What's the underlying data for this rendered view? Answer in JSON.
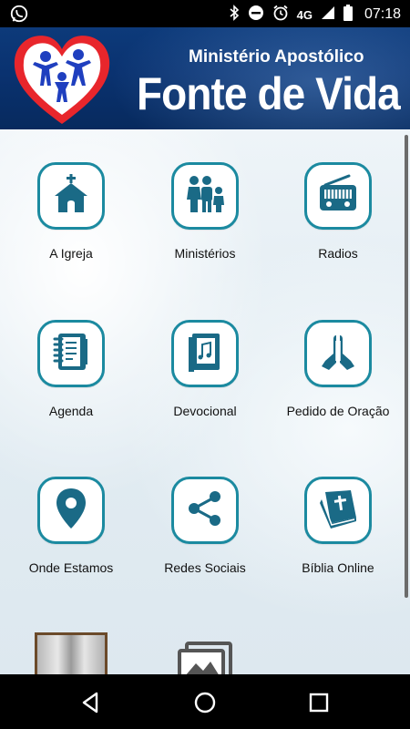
{
  "status_bar": {
    "network": "4G",
    "time": "07:18",
    "icons": [
      "whatsapp-icon",
      "bluetooth-icon",
      "do-not-disturb-icon",
      "alarm-icon",
      "signal-icon",
      "battery-icon"
    ]
  },
  "header": {
    "subtitle": "Ministério Apostólico",
    "title": "Fonte de Vida",
    "logo": "heart-family-logo"
  },
  "menu": {
    "items": [
      {
        "label": "A Igreja",
        "icon": "church-icon"
      },
      {
        "label": "Ministérios",
        "icon": "people-icon"
      },
      {
        "label": "Radios",
        "icon": "radio-icon"
      },
      {
        "label": "Agenda",
        "icon": "notebook-icon"
      },
      {
        "label": "Devocional",
        "icon": "music-book-icon"
      },
      {
        "label": "Pedido de Oração",
        "icon": "praying-hands-icon"
      },
      {
        "label": "Onde Estamos",
        "icon": "location-pin-icon"
      },
      {
        "label": "Redes Sociais",
        "icon": "share-icon"
      },
      {
        "label": "Bíblia Online",
        "icon": "bible-icon"
      }
    ],
    "partial_items": [
      "bible-photo-thumbnail",
      "gallery-icon"
    ]
  },
  "nav_bar": {
    "icons": [
      "back-icon",
      "home-icon",
      "recents-icon"
    ]
  },
  "colors": {
    "accent": "#1b8aa0",
    "icon_fill": "#1a6a86",
    "header_bg": "#0a3270",
    "logo_heart": "#e8262c",
    "logo_figures": "#1f3fbf"
  }
}
